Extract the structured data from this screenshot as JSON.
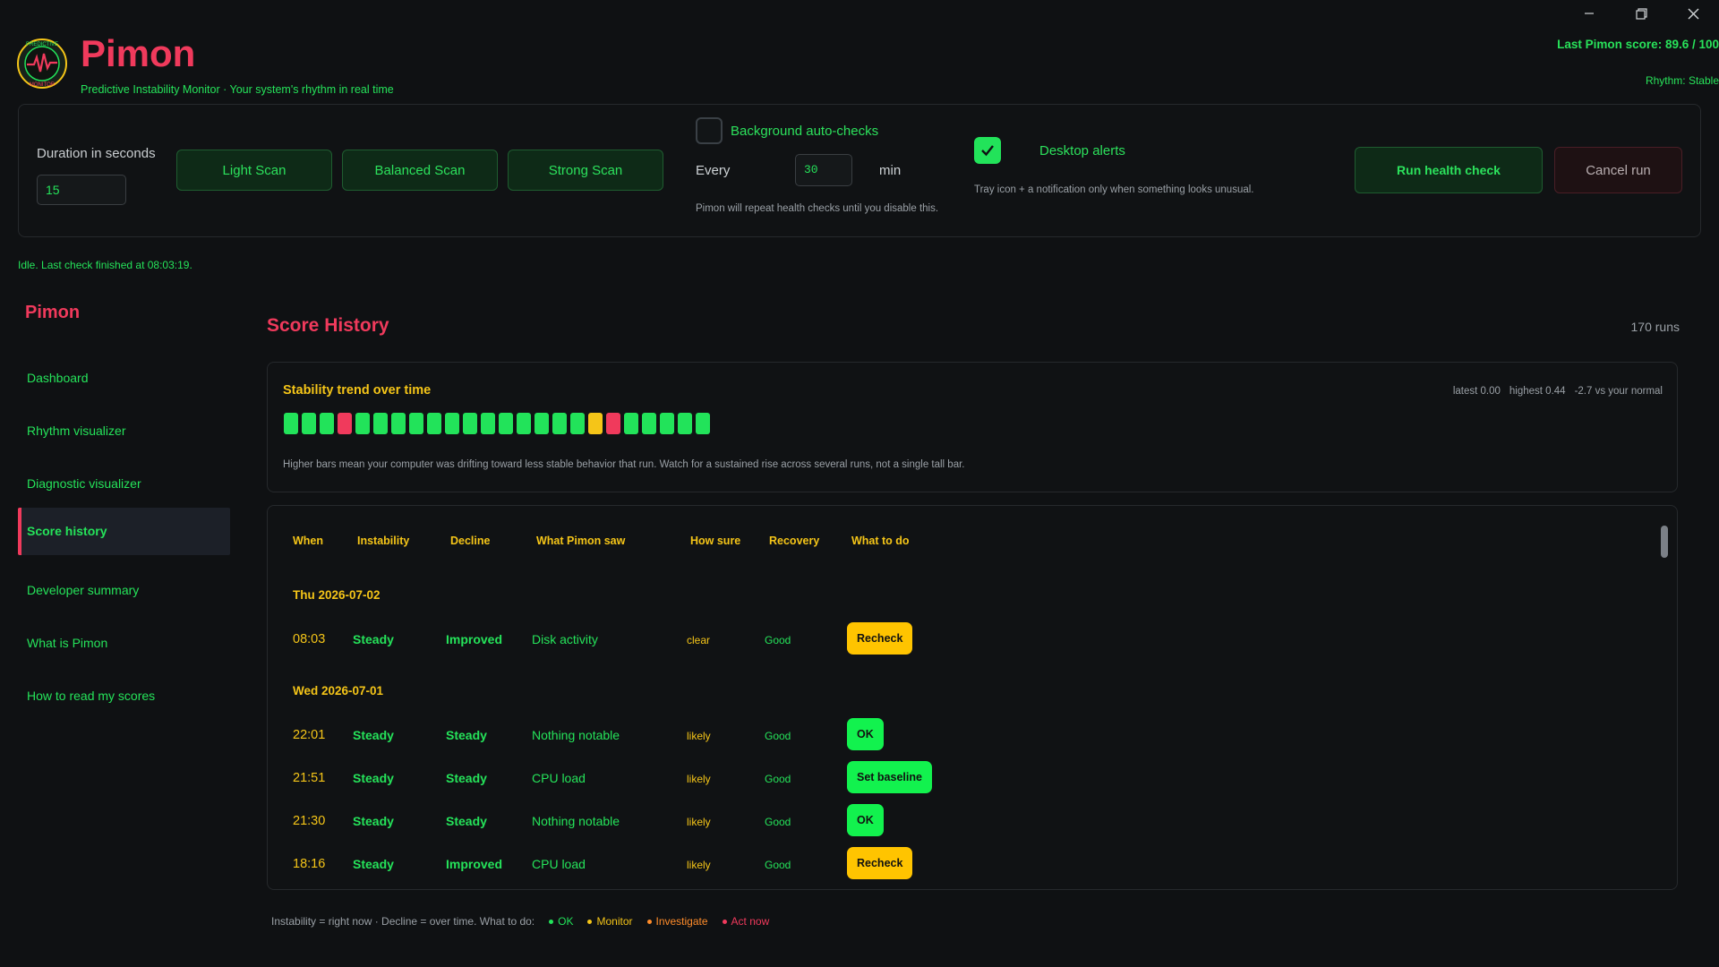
{
  "window": {
    "minimize_icon": "minimize-icon",
    "restore_icon": "restore-icon",
    "close_icon": "close-icon"
  },
  "header": {
    "title": "Pimon",
    "subtitle": "Predictive Instability Monitor · Your system's rhythm in real time",
    "last_score": "Last Pimon score: 89.6 / 100",
    "rhythm": "Rhythm: Stable",
    "logo_text_top": "PREDICTIVE",
    "logo_text_bottom": "MONITOR"
  },
  "controls": {
    "duration_label": "Duration in seconds",
    "duration_value": "15",
    "scans": [
      "Light Scan",
      "Balanced Scan",
      "Strong Scan"
    ],
    "bg_checks_label": "Background auto-checks",
    "bg_checks_checked": false,
    "every_label": "Every",
    "every_value": "30",
    "min_label": "min",
    "bg_help": "Pimon will repeat health checks until you disable this.",
    "alerts_label": "Desktop alerts",
    "alerts_checked": true,
    "alerts_help": "Tray icon + a notification only when something looks unusual.",
    "run_label": "Run health check",
    "cancel_label": "Cancel run"
  },
  "status": "Idle. Last check finished at 08:03:19.",
  "sidebar": {
    "title": "Pimon",
    "items": [
      {
        "label": "Dashboard",
        "active": false
      },
      {
        "label": "Rhythm visualizer",
        "active": false
      },
      {
        "label": "Diagnostic visualizer",
        "active": false
      },
      {
        "label": "Score history",
        "active": true
      },
      {
        "label": "Developer summary",
        "active": false
      },
      {
        "label": "What is Pimon",
        "active": false
      },
      {
        "label": "How to read my scores",
        "active": false
      }
    ]
  },
  "main": {
    "title": "Score History",
    "runs": "170 runs",
    "trend": {
      "title": "Stability trend over time",
      "latest": "latest 0.00",
      "highest": "highest 0.44",
      "vs_normal": "-2.7 vs your normal",
      "help": "Higher bars mean your computer was drifting toward less stable behavior that run. Watch for a sustained rise across several runs, not a single tall bar.",
      "bars": [
        "green",
        "green",
        "green",
        "red",
        "green",
        "green",
        "green",
        "green",
        "green",
        "green",
        "green",
        "green",
        "green",
        "green",
        "green",
        "green",
        "green",
        "yellow",
        "red",
        "green",
        "green",
        "green",
        "green",
        "green"
      ]
    },
    "colors": {
      "green": "#22e35a",
      "yellow": "#f5c518",
      "red": "#f03a5c",
      "orange": "#ff8c2a"
    },
    "table": {
      "headers": [
        "When",
        "Instability",
        "Decline",
        "What Pimon saw",
        "How sure",
        "Recovery",
        "What to do"
      ],
      "days": [
        {
          "label": "Thu  2026-07-02"
        },
        {
          "label": "Wed  2026-07-01"
        }
      ],
      "rows": [
        {
          "when": "08:03",
          "instability": "Steady",
          "decline": "Improved",
          "saw": "Disk activity",
          "sure": "clear",
          "recovery": "Good",
          "action": "Recheck",
          "action_color": "yellow"
        },
        {
          "when": "22:01",
          "instability": "Steady",
          "decline": "Steady",
          "saw": "Nothing notable",
          "sure": "likely",
          "recovery": "Good",
          "action": "OK",
          "action_color": "green"
        },
        {
          "when": "21:51",
          "instability": "Steady",
          "decline": "Steady",
          "saw": "CPU load",
          "sure": "likely",
          "recovery": "Good",
          "action": "Set baseline",
          "action_color": "green"
        },
        {
          "when": "21:30",
          "instability": "Steady",
          "decline": "Steady",
          "saw": "Nothing notable",
          "sure": "likely",
          "recovery": "Good",
          "action": "OK",
          "action_color": "green"
        },
        {
          "when": "18:16",
          "instability": "Steady",
          "decline": "Improved",
          "saw": "CPU load",
          "sure": "likely",
          "recovery": "Good",
          "action": "Recheck",
          "action_color": "yellow"
        }
      ]
    },
    "legend": {
      "text": "Instability = right now  ·  Decline = over time.  What to do:",
      "items": [
        {
          "label": "OK",
          "color": "#22e35a"
        },
        {
          "label": "Monitor",
          "color": "#f5c518"
        },
        {
          "label": "Investigate",
          "color": "#ff8c2a"
        },
        {
          "label": "Act now",
          "color": "#f03a5c"
        }
      ]
    }
  }
}
